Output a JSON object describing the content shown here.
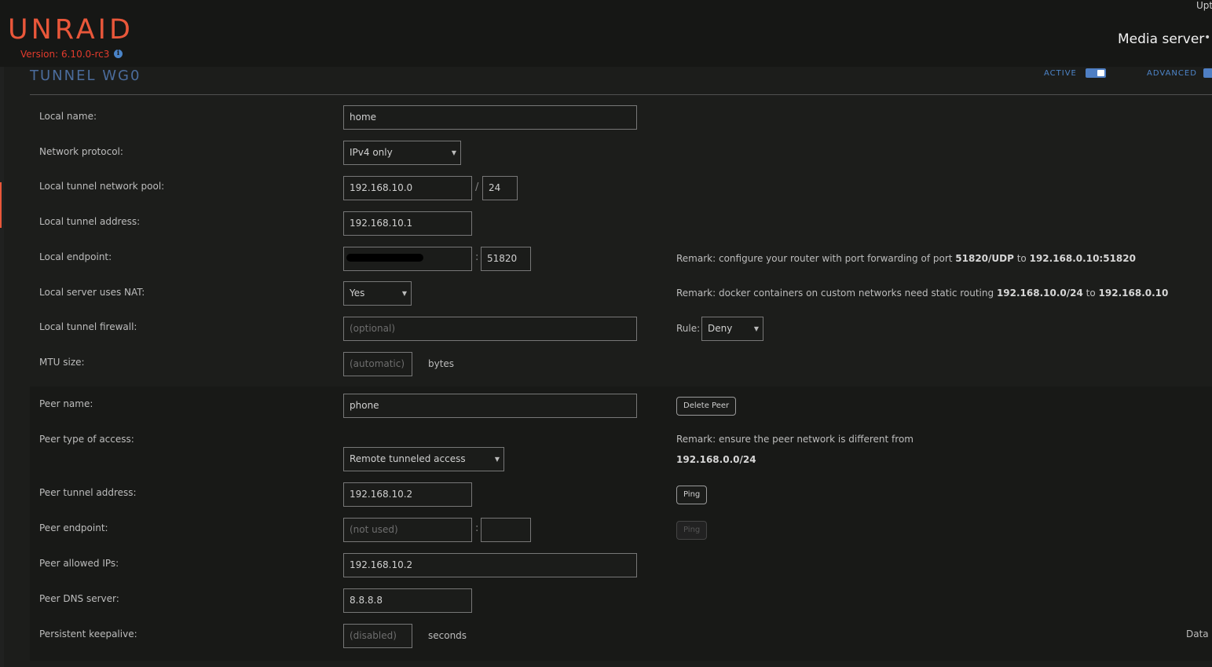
{
  "header": {
    "logo": "UNRAID",
    "version": "Version: 6.10.0-rc3",
    "info_icon": "info-icon",
    "uptime_label": "Upt",
    "server_name": "Media server",
    "server_dot": "•"
  },
  "section": {
    "title": "TUNNEL WG0",
    "active_label": "ACTIVE",
    "advanced_label": "ADVANCED",
    "toggle_color": "#4f7fc4"
  },
  "local": {
    "name_label": "Local name:",
    "name_value": "home",
    "protocol_label": "Network protocol:",
    "protocol_value": "IPv4 only",
    "pool_label": "Local tunnel network pool:",
    "pool_value": "192.168.10.0",
    "pool_sep": "/",
    "pool_mask": "24",
    "address_label": "Local tunnel address:",
    "address_value": "192.168.10.1",
    "endpoint_label": "Local endpoint:",
    "endpoint_sep": ":",
    "endpoint_port": "51820",
    "endpoint_remark_prefix": "Remark: configure your router with port forwarding of port ",
    "endpoint_remark_port": "51820/UDP",
    "endpoint_remark_to": " to ",
    "endpoint_remark_target": "192.168.0.10:51820",
    "nat_label": "Local server uses NAT:",
    "nat_value": "Yes",
    "nat_remark_prefix": "Remark: docker containers on custom networks need static routing ",
    "nat_remark_net": "192.168.10.0/24",
    "nat_remark_to": " to ",
    "nat_remark_target": "192.168.0.10",
    "firewall_label": "Local tunnel firewall:",
    "firewall_placeholder": "(optional)",
    "rule_label": "Rule:",
    "rule_value": "Deny",
    "mtu_label": "MTU size:",
    "mtu_placeholder": "(automatic)",
    "mtu_unit": "bytes"
  },
  "peer": {
    "name_label": "Peer name:",
    "name_value": "phone",
    "delete_button": "Delete Peer",
    "access_label": "Peer type of access:",
    "access_value": "Remote tunneled access",
    "access_remark": "Remark: ensure the peer network is different from",
    "access_remark_net": "192.168.0.0/24",
    "tunnel_address_label": "Peer tunnel address:",
    "tunnel_address_value": "192.168.10.2",
    "ping_button": "Ping",
    "endpoint_label": "Peer endpoint:",
    "endpoint_placeholder": "(not used)",
    "endpoint_sep": ":",
    "endpoint_ping_button": "Ping",
    "allowed_ips_label": "Peer allowed IPs:",
    "allowed_ips_value": "192.168.10.2",
    "dns_label": "Peer DNS server:",
    "dns_value": "8.8.8.8",
    "keepalive_label": "Persistent keepalive:",
    "keepalive_placeholder": "(disabled)",
    "keepalive_unit": "seconds",
    "data_label": "Data"
  }
}
